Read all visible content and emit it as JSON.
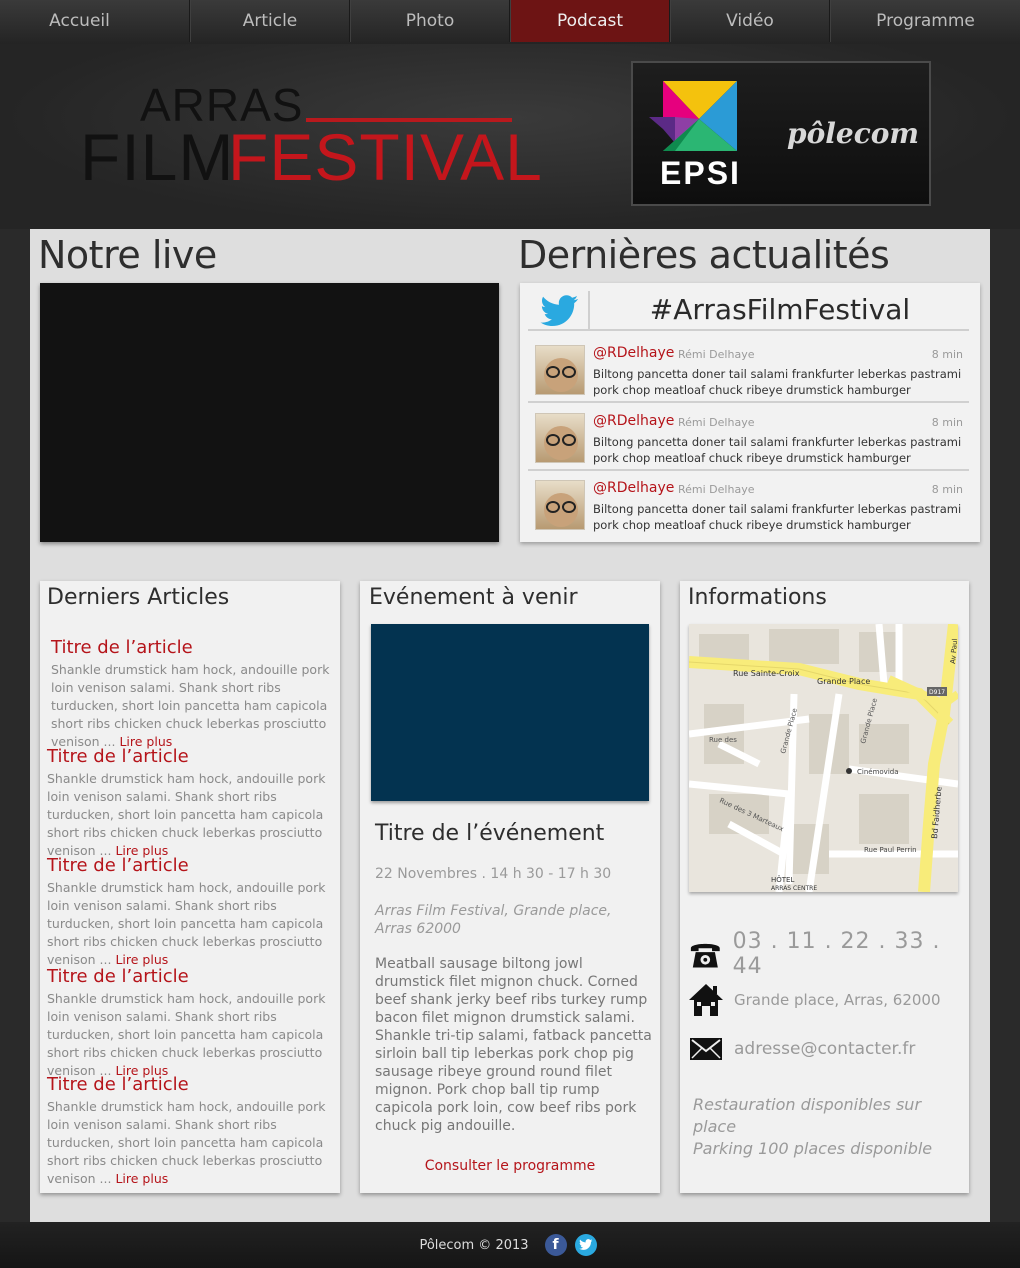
{
  "nav": {
    "items": [
      {
        "label": "Accueil"
      },
      {
        "label": "Article"
      },
      {
        "label": "Photo"
      },
      {
        "label": "Podcast"
      },
      {
        "label": "Vidéo"
      },
      {
        "label": "Programme"
      }
    ],
    "active": "Podcast"
  },
  "header": {
    "logo_top": "ARRAS",
    "logo_film": "FILM",
    "logo_festival": "FESTIVAL",
    "sponsor_epsi": "EPSI",
    "sponsor_polecom": "pôlecom"
  },
  "live": {
    "title": "Notre live"
  },
  "news": {
    "title": "Dernières actualités",
    "hashtag": "#ArrasFilmFestival",
    "tweets": [
      {
        "user": "@RDelhaye",
        "name": "Rémi Delhaye",
        "time": "8 min",
        "text": "Biltong pancetta doner tail salami frankfurter leberkas pastrami pork chop meatloaf chuck ribeye drumstick hamburger"
      },
      {
        "user": "@RDelhaye",
        "name": "Rémi Delhaye",
        "time": "8 min",
        "text": "Biltong pancetta doner tail salami frankfurter leberkas pastrami pork chop meatloaf chuck ribeye drumstick hamburger"
      },
      {
        "user": "@RDelhaye",
        "name": "Rémi Delhaye",
        "time": "8 min",
        "text": "Biltong pancetta doner tail salami frankfurter leberkas pastrami pork chop meatloaf chuck ribeye drumstick hamburger"
      }
    ]
  },
  "articles": {
    "title": "Derniers Articles",
    "more_label": "Lire plus",
    "items": [
      {
        "title": "Titre de l’article",
        "body": "Shankle drumstick ham hock, andouille pork loin venison salami. Shank short ribs turducken, short loin pancetta ham capicola short ribs chicken chuck leberkas prosciutto venison ..."
      },
      {
        "title": "Titre de l’article",
        "body": "Shankle drumstick ham hock, andouille pork loin venison salami. Shank short ribs turducken, short loin pancetta ham capicola short ribs chicken chuck leberkas prosciutto venison ..."
      },
      {
        "title": "Titre de l’article",
        "body": "Shankle drumstick ham hock, andouille pork loin venison salami. Shank short ribs turducken, short loin pancetta ham capicola short ribs chicken chuck leberkas prosciutto venison ..."
      },
      {
        "title": "Titre de l’article",
        "body": "Shankle drumstick ham hock, andouille pork loin venison salami. Shank short ribs turducken, short loin pancetta ham capicola short ribs chicken chuck leberkas prosciutto venison ..."
      },
      {
        "title": "Titre de l’article",
        "body": "Shankle drumstick ham hock, andouille pork loin venison salami. Shank short ribs turducken, short loin pancetta ham capicola short ribs chicken chuck leberkas prosciutto venison ..."
      }
    ]
  },
  "event": {
    "title": "Evénement à venir",
    "event_title": "Titre de l’événement",
    "date": "22 Novembres . 14 h 30 - 17 h 30",
    "place": "Arras Film Festival, Grande place, Arras 62000",
    "description": "Meatball sausage biltong jowl drumstick filet mignon chuck. Corned beef shank jerky beef ribs turkey rump bacon filet mignon drumstick salami. Shankle tri-tip salami, fatback pancetta sirloin ball tip leberkas pork chop pig sausage ribeye ground round filet mignon. Pork chop ball tip rump capicola pork loin, cow beef ribs pork chuck pig andouille.",
    "link": "Consulter le programme"
  },
  "info": {
    "title": "Informations",
    "map_labels": {
      "rue_sainte_croix": "Rue Sainte-Croix",
      "grande_place": "Grande Place",
      "grande_place_2": "Grande Place",
      "grande_place_3": "Grande Place",
      "rue_des_rosati": "Rue des",
      "rue_3_marteaux": "Rue des 3 Marteaux",
      "cinemovida": "Cinémovida",
      "bd_faidherbe": "Bd Faidherbe",
      "rue_paul_perrin": "Rue Paul Perrin",
      "hotel": "HÔTEL",
      "arras_centre": "ARRAS CENTRE",
      "d917": "D917",
      "av_paul": "Av Paul"
    },
    "phone": "03 . 11 . 22 . 33 . 44",
    "address": "Grande place, Arras, 62000",
    "email": "adresse@contacter.fr",
    "note_1": "Restauration disponibles sur place",
    "note_2": "Parking 100 places disponible"
  },
  "footer": {
    "text": "Pôlecom  ©  2013"
  },
  "colors": {
    "accent": "#b5141a",
    "nav_active": "#6d1414",
    "event_image": "#033350"
  }
}
